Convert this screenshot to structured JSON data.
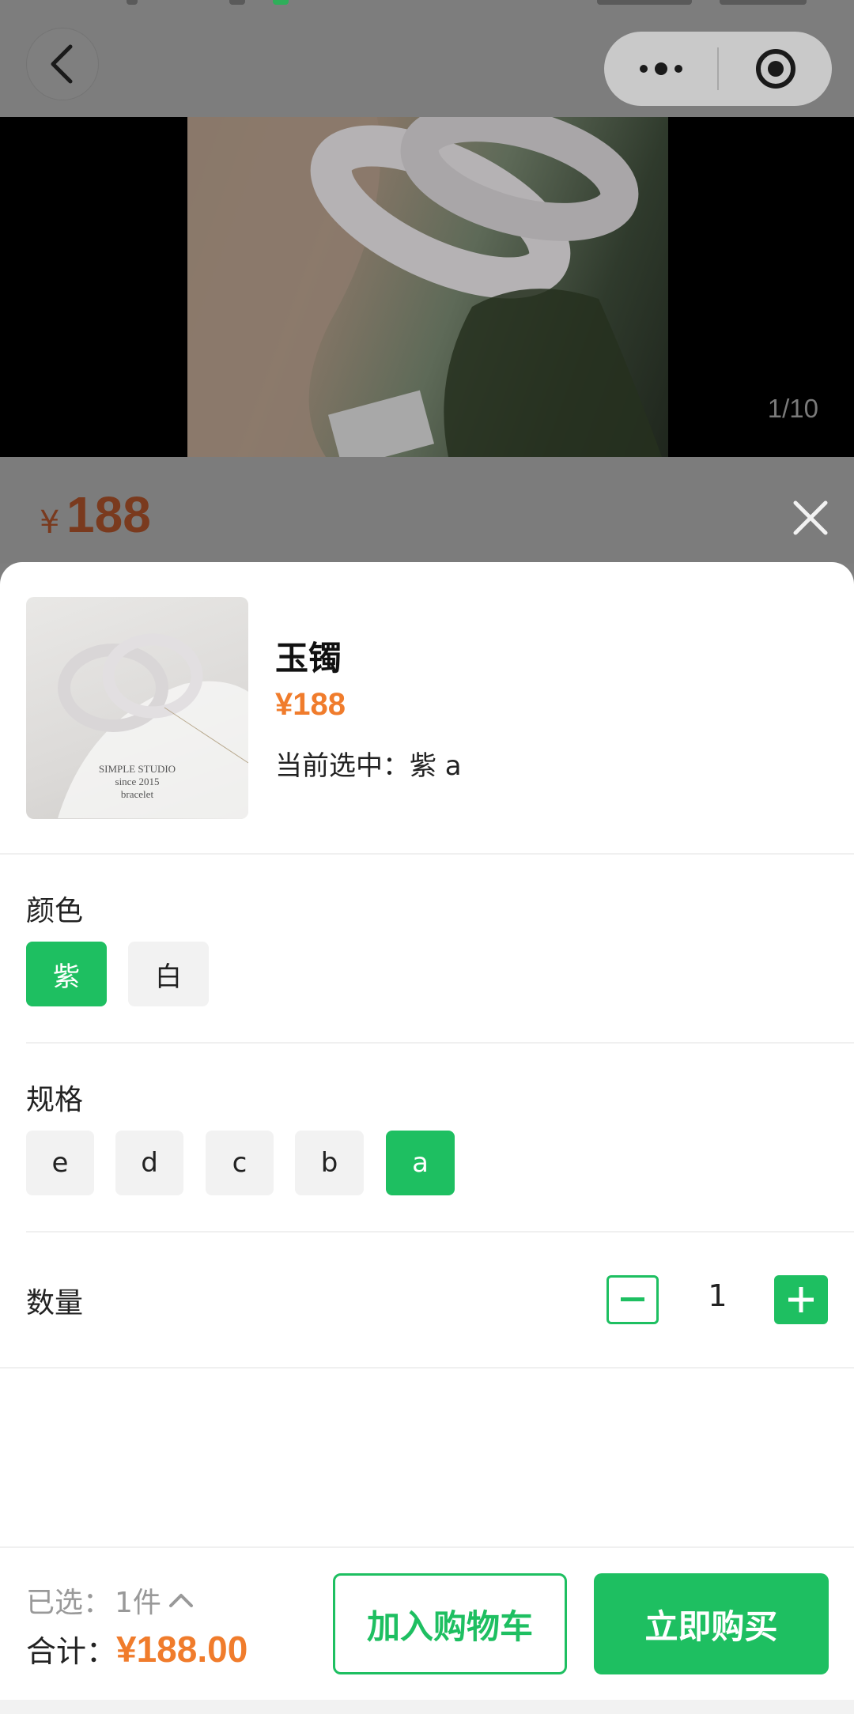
{
  "navbar": {
    "back_icon": "chevron-left-icon",
    "more_icon": "more-dots-icon",
    "target_icon": "target-circle-icon"
  },
  "gallery": {
    "counter": "1/10"
  },
  "product_header": {
    "currency": "¥",
    "price": "188",
    "close_icon": "close-icon"
  },
  "sheet": {
    "name": "玉镯",
    "price": "¥188",
    "selected_text": "当前选中：紫 a",
    "thumbnail_caption": [
      "SIMPLE STUDIO",
      "since 2015",
      "bracelet"
    ]
  },
  "color_section": {
    "label": "颜色",
    "options": [
      "紫",
      "白"
    ],
    "selected": "紫"
  },
  "spec_section": {
    "label": "规格",
    "options": [
      "e",
      "d",
      "c",
      "b",
      "a"
    ],
    "selected": "a"
  },
  "quantity_section": {
    "label": "数量",
    "value": "1",
    "minus_icon": "minus-icon",
    "plus_icon": "plus-icon"
  },
  "footer": {
    "selected_label": "已选：",
    "selected_count": "1件",
    "chevron_icon": "chevron-up-icon",
    "total_label": "合计：",
    "total_amount": "¥188.00",
    "add_to_cart": "加入购物车",
    "buy_now": "立即购买"
  },
  "colors": {
    "accent": "#1ebf61",
    "price": "#f07c2c"
  }
}
